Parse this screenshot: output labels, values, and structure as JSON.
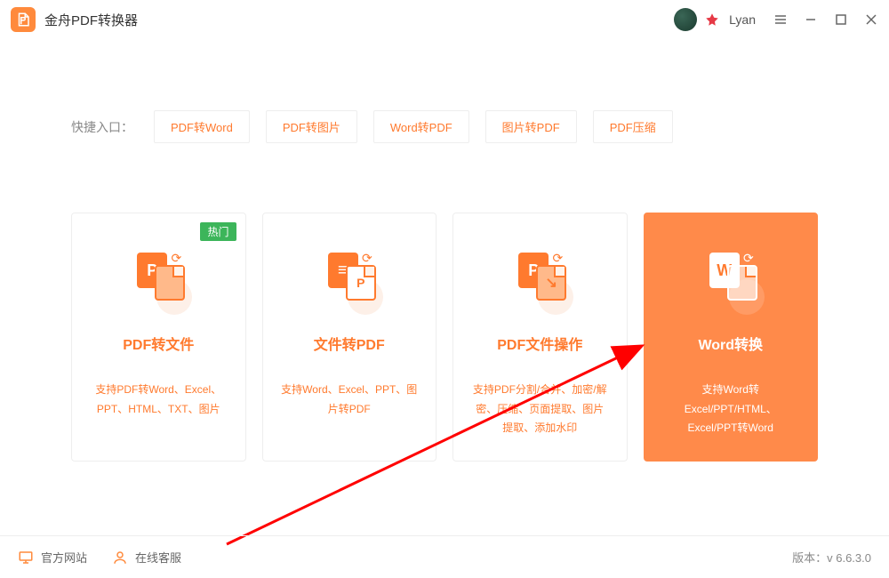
{
  "app": {
    "title": "金舟PDF转换器"
  },
  "user": {
    "name": "Lyan"
  },
  "quick": {
    "label": "快捷入口：",
    "items": [
      "PDF转Word",
      "PDF转图片",
      "Word转PDF",
      "图片转PDF",
      "PDF压缩"
    ]
  },
  "cards": [
    {
      "title": "PDF转文件",
      "badge": "热门",
      "desc": "支持PDF转Word、Excel、PPT、HTML、TXT、图片",
      "iconL": "P"
    },
    {
      "title": "文件转PDF",
      "desc": "支持Word、Excel、PPT、图片转PDF",
      "iconL": "≡",
      "iconR": "P"
    },
    {
      "title": "PDF文件操作",
      "desc": "支持PDF分割/合并、加密/解密、压缩、页面提取、图片提取、添加水印",
      "iconL": "P"
    },
    {
      "title": "Word转换",
      "desc": "支持Word转Excel/PPT/HTML、Excel/PPT转Word",
      "iconL": "W",
      "active": true
    }
  ],
  "footer": {
    "official": "官方网站",
    "support": "在线客服",
    "versionLabel": "版本：",
    "version": "v 6.6.3.0"
  }
}
